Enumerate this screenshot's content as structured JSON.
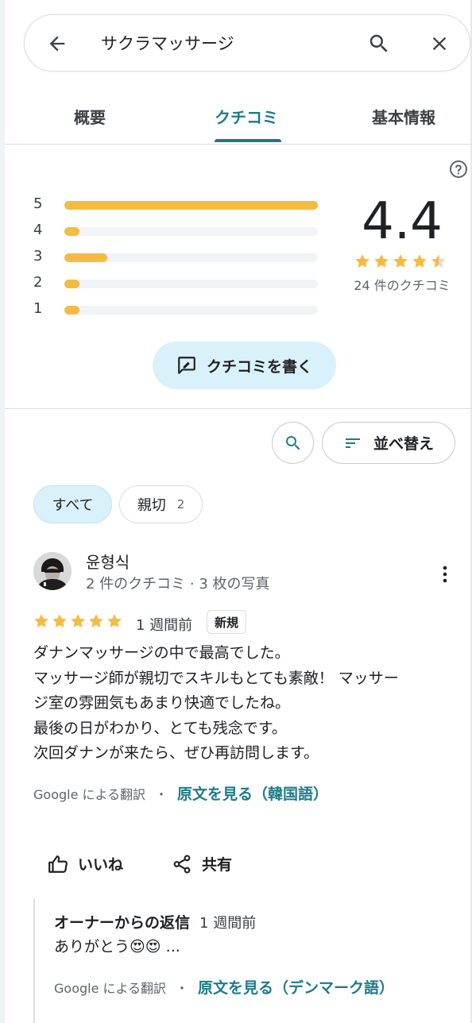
{
  "search": {
    "query": "サクラマッサージ",
    "back_icon": "arrow-left-icon",
    "search_icon": "search-icon",
    "close_icon": "close-icon"
  },
  "tabs": [
    {
      "label": "概要",
      "active": false
    },
    {
      "label": "クチコミ",
      "active": true
    },
    {
      "label": "基本情報",
      "active": false
    }
  ],
  "colors": {
    "accent": "#1f7a88",
    "star": "#f4bb44",
    "chip_bg": "#d9f1fa"
  },
  "ratings": {
    "average": "4.4",
    "average_value": 4.4,
    "count_label": "24 件のクチコミ",
    "distribution": [
      {
        "stars": "5",
        "fraction": 1.0
      },
      {
        "stars": "4",
        "fraction": 0.06
      },
      {
        "stars": "3",
        "fraction": 0.17
      },
      {
        "stars": "2",
        "fraction": 0.06
      },
      {
        "stars": "1",
        "fraction": 0.06
      }
    ]
  },
  "write_review": {
    "label": "クチコミを書く",
    "icon": "write-review-icon"
  },
  "sort": {
    "label": "並べ替え",
    "icon": "sort-icon"
  },
  "chips": {
    "all_label": "すべて",
    "kind_label": "親切",
    "kind_count": "2"
  },
  "review": {
    "author": "윤형식",
    "author_meta": "2 件のクチコミ · 3 枚の写真",
    "rating": 5,
    "date": "1 週間前",
    "badge": "新規",
    "text_lines": [
      "ダナンマッサージの中で最高でした。",
      "マッサージ師が親切でスキルもとても素敵！ マッサー",
      "ジ室の雰囲気もあまり快適でしたね。",
      "最後の日がわかり、とても残念です。",
      "次回ダナンが来たら、ぜひ再訪問します。"
    ],
    "translated_by": "Google による翻訳",
    "dot": "・",
    "original_link": "原文を見る（韓国語）",
    "like_label": "いいね",
    "share_label": "共有"
  },
  "owner_reply": {
    "title": "オーナーからの返信",
    "date": "1 週間前",
    "text": "ありがとう😍😍 ...",
    "translated_by": "Google による翻訳",
    "dot": "・",
    "original_link": "原文を見る（デンマーク語）"
  }
}
